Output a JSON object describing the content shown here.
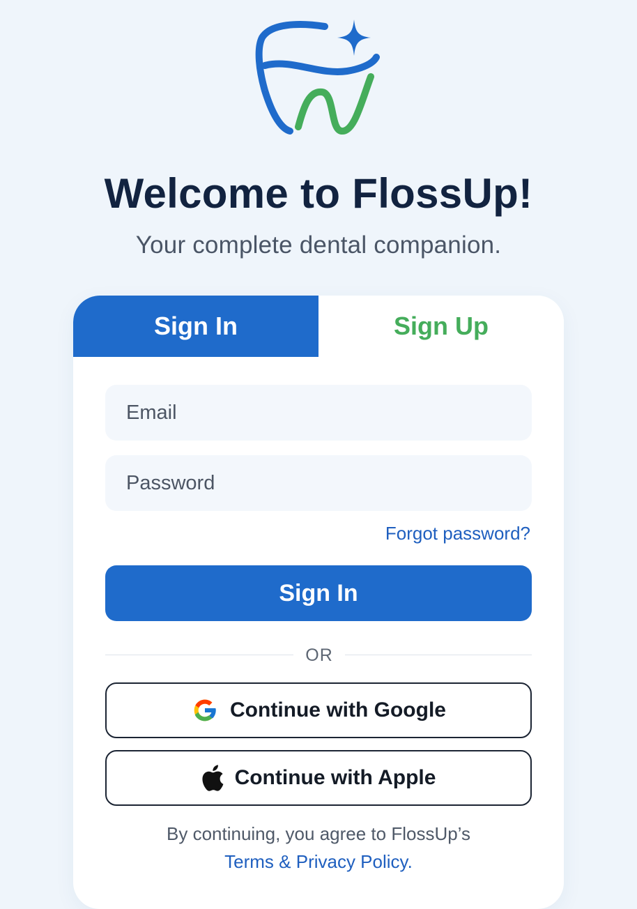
{
  "app": {
    "title": "Welcome to FlossUp!",
    "subtitle": "Your complete dental companion.",
    "logo_icon": "tooth-sparkle-logo"
  },
  "colors": {
    "primary": "#1f6bcb",
    "accent_green": "#45ad5b",
    "title": "#122340",
    "background": "#eff5fb"
  },
  "tabs": [
    {
      "label": "Sign In",
      "active": true
    },
    {
      "label": "Sign Up",
      "active": false
    }
  ],
  "form": {
    "email": {
      "placeholder": "Email",
      "value": ""
    },
    "password": {
      "placeholder": "Password",
      "value": ""
    },
    "forgot_label": "Forgot password?",
    "submit_label": "Sign In"
  },
  "divider": {
    "label": "OR"
  },
  "social": {
    "google": {
      "label": "Continue with Google",
      "icon": "google-icon"
    },
    "apple": {
      "label": "Continue with Apple",
      "icon": "apple-icon"
    }
  },
  "legal": {
    "text": "By continuing, you agree to FlossUp’s",
    "link_label": "Terms & Privacy Policy."
  }
}
